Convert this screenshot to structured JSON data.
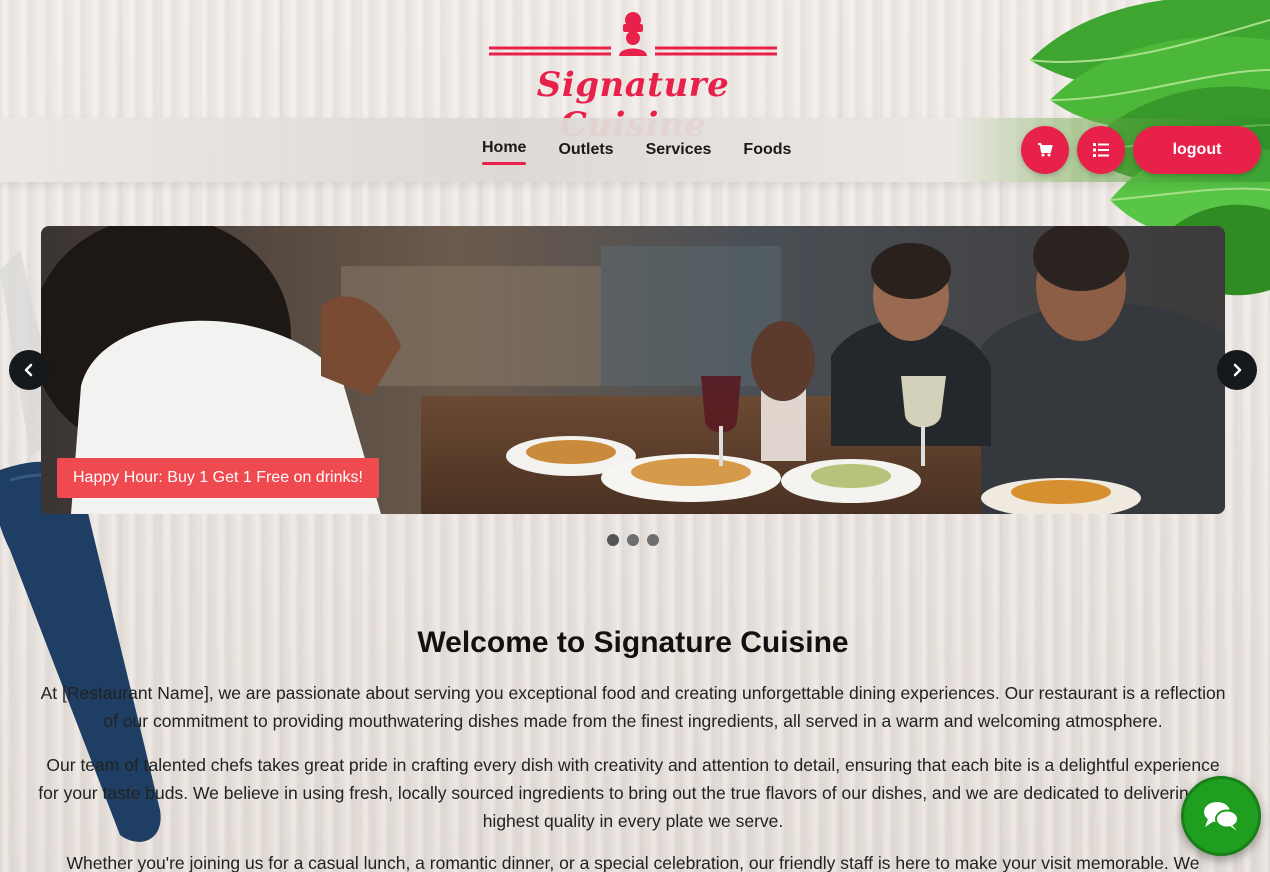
{
  "brand": {
    "name": "Signature Cuisine",
    "color": "#e8214b"
  },
  "nav": {
    "links": [
      {
        "label": "Home",
        "active": true
      },
      {
        "label": "Outlets",
        "active": false
      },
      {
        "label": "Services",
        "active": false
      },
      {
        "label": "Foods",
        "active": false
      }
    ],
    "cart_icon": "cart-icon",
    "list_icon": "list-icon",
    "logout_label": "logout"
  },
  "carousel": {
    "promo": "Happy Hour: Buy 1 Get 1 Free on drinks!",
    "slide_count": 3,
    "active_slide": 1
  },
  "content": {
    "title": "Welcome to Signature Cuisine",
    "paragraphs": [
      "At [Restaurant Name], we are passionate about serving you exceptional food and creating unforgettable dining experiences. Our restaurant is a reflection of our commitment to providing mouthwatering dishes made from the finest ingredients, all served in a warm and welcoming atmosphere.",
      "Our team of talented chefs takes great pride in crafting every dish with creativity and attention to detail, ensuring that each bite is a delightful experience for your taste buds. We believe in using fresh, locally sourced ingredients to bring out the true flavors of our dishes, and we are dedicated to delivering the highest quality in every plate we serve.",
      "Whether you're joining us for a casual lunch, a romantic dinner, or a special celebration, our friendly staff is here to make your visit memorable. We"
    ]
  },
  "chat": {
    "icon": "chat-icon",
    "color": "#1f9e1f"
  }
}
